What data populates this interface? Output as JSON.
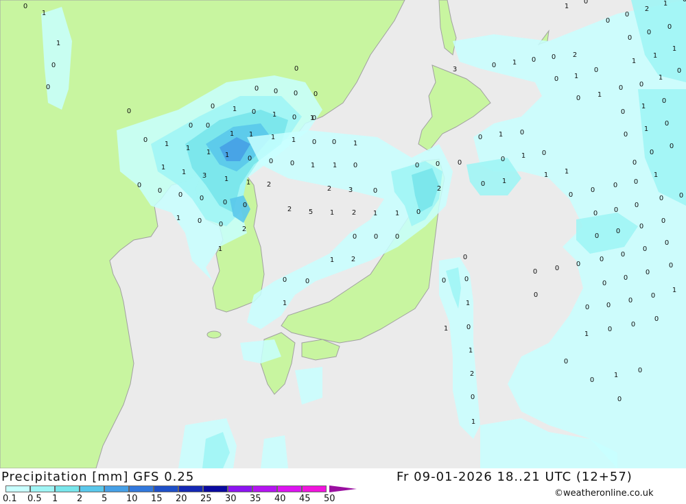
{
  "title": "Precipitation [mm] GFS 0.25",
  "datetime": "Fr 09-01-2026 18..21 UTC (12+57)",
  "credit": "©weatheronline.co.uk",
  "colors": {
    "sea": "#ebebeb",
    "land": "#c8f5a0",
    "border": "#a0a0a0",
    "precip": [
      "#c8ffff",
      "#a0f5f5",
      "#78e6eb",
      "#5ac8eb",
      "#46a0e6",
      "#3278dc",
      "#1e50c8",
      "#1428b4",
      "#0a0aa0",
      "#8c14f0",
      "#b414f0",
      "#dc14f0",
      "#f014dc",
      "#dc14b4"
    ]
  },
  "legend": {
    "labels": [
      "0.1",
      "0.5",
      "1",
      "2",
      "5",
      "10",
      "15",
      "20",
      "25",
      "30",
      "35",
      "40",
      "45",
      "50"
    ]
  },
  "map_values": [
    "0",
    "1",
    "1",
    "0",
    "0",
    "0",
    "0",
    "0",
    "0",
    "0",
    "0",
    "0",
    "0",
    "0",
    "0",
    "0",
    "1",
    "0",
    "1",
    "0",
    "1",
    "0",
    "1",
    "1",
    "1",
    "1",
    "1",
    "1",
    "1",
    "1",
    "0",
    "1",
    "0",
    "1",
    "1",
    "3",
    "1",
    "0",
    "0",
    "0",
    "1",
    "2",
    "3",
    "0",
    "0",
    "0",
    "0",
    "0",
    "1",
    "1",
    "2",
    "2",
    "5",
    "1",
    "2",
    "1",
    "0",
    "0",
    "0",
    "0",
    "1",
    "1",
    "0",
    "2",
    "0",
    "0",
    "0",
    "0",
    "1",
    "0",
    "0",
    "1",
    "0",
    "1",
    "1",
    "0",
    "1",
    "1",
    "2",
    "1",
    "2",
    "0",
    "0",
    "0",
    "0",
    "0",
    "1",
    "0",
    "0",
    "0",
    "1",
    "0",
    "1",
    "2",
    "0",
    "1",
    "1",
    "3",
    "0",
    "1",
    "0",
    "0",
    "2",
    "0",
    "1",
    "0",
    "0",
    "1",
    "0",
    "0",
    "1",
    "0",
    "0",
    "0",
    "2",
    "1",
    "0",
    "0",
    "1",
    "0",
    "0",
    "0",
    "1",
    "1",
    "1",
    "0",
    "1",
    "0",
    "0",
    "1",
    "0",
    "0",
    "0",
    "0",
    "1",
    "0",
    "0",
    "0",
    "0",
    "0",
    "0",
    "0",
    "0",
    "0",
    "0",
    "0",
    "0",
    "0",
    "0",
    "0",
    "0",
    "0",
    "0",
    "0",
    "0",
    "0",
    "0",
    "0",
    "0",
    "0",
    "0",
    "0",
    "0",
    "1",
    "0",
    "1",
    "0",
    "0",
    "0",
    "0",
    "0",
    "1",
    "0",
    "0"
  ]
}
